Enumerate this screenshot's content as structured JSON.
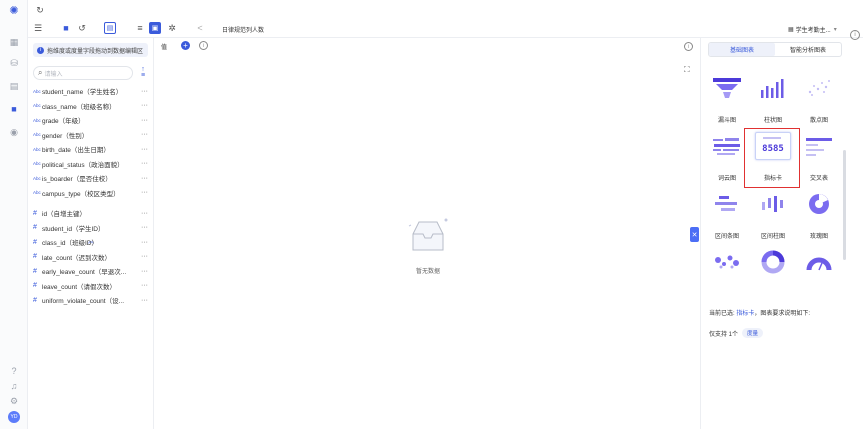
{
  "topbar": {
    "report_name": "日律规范列人数",
    "dataset_label": "学生考勤主...",
    "tool_icons": [
      "menu-icon",
      "save-icon",
      "refresh-icon",
      "table-view-icon",
      "filter-icon",
      "grid-icon",
      "settings-icon",
      "share-icon"
    ]
  },
  "field_panel": {
    "hint": "拖维度或度量字段拖动到数据编辑区",
    "search_placeholder": "请输入",
    "dimension_tag": "Abc",
    "dimensions": [
      "student_name（学生姓名）",
      "class_name（班级名称）",
      "grade（年级）",
      "gender（性别）",
      "birth_date（出生日期）",
      "political_status（政治面貌）",
      "is_boarder（是否住校）",
      "campus_type（校区类型）"
    ],
    "measures": [
      "id（自增主键）",
      "student_id（学生ID）",
      "class_id（班级ID）",
      "late_count（迟到次数）",
      "early_leave_count（早退次...",
      "leave_count（请假次数）",
      "uniform_violate_count（设..."
    ],
    "more_glyph": "···",
    "hash_glyph": "#"
  },
  "canvas": {
    "header_label": "值",
    "empty_text": "暂无数据"
  },
  "right_panel": {
    "tabs": [
      "基础图表",
      "智能分析图表"
    ],
    "active_tab": 0,
    "charts": [
      {
        "label": "漏斗图",
        "icon": "funnel-chart-icon"
      },
      {
        "label": "柱状图",
        "icon": "bar-chart-icon"
      },
      {
        "label": "散点图",
        "icon": "scatter-chart-icon"
      },
      {
        "label": "词云图",
        "icon": "word-cloud-icon"
      },
      {
        "label": "指标卡",
        "icon": "kpi-card-icon",
        "preview_value": "8585"
      },
      {
        "label": "交叉表",
        "icon": "cross-table-icon"
      },
      {
        "label": "区间条图",
        "icon": "range-bar-icon"
      },
      {
        "label": "区间柱图",
        "icon": "range-column-icon"
      },
      {
        "label": "玫瑰图",
        "icon": "rose-chart-icon"
      },
      {
        "label": "",
        "icon": "map-chart-icon"
      },
      {
        "label": "",
        "icon": "ring-chart-icon"
      },
      {
        "label": "",
        "icon": "gauge-chart-icon"
      }
    ],
    "selected_index": 4,
    "current_prefix": "当前已选: ",
    "current_chart": "指标卡",
    "current_suffix": "，图表要求说明如下:",
    "support_text": "仅支持 1个",
    "support_pill": "度量"
  },
  "colors": {
    "accent": "#3b5bdb",
    "selected_border": "#e03131",
    "chart_purple": "#6c5ce7"
  }
}
